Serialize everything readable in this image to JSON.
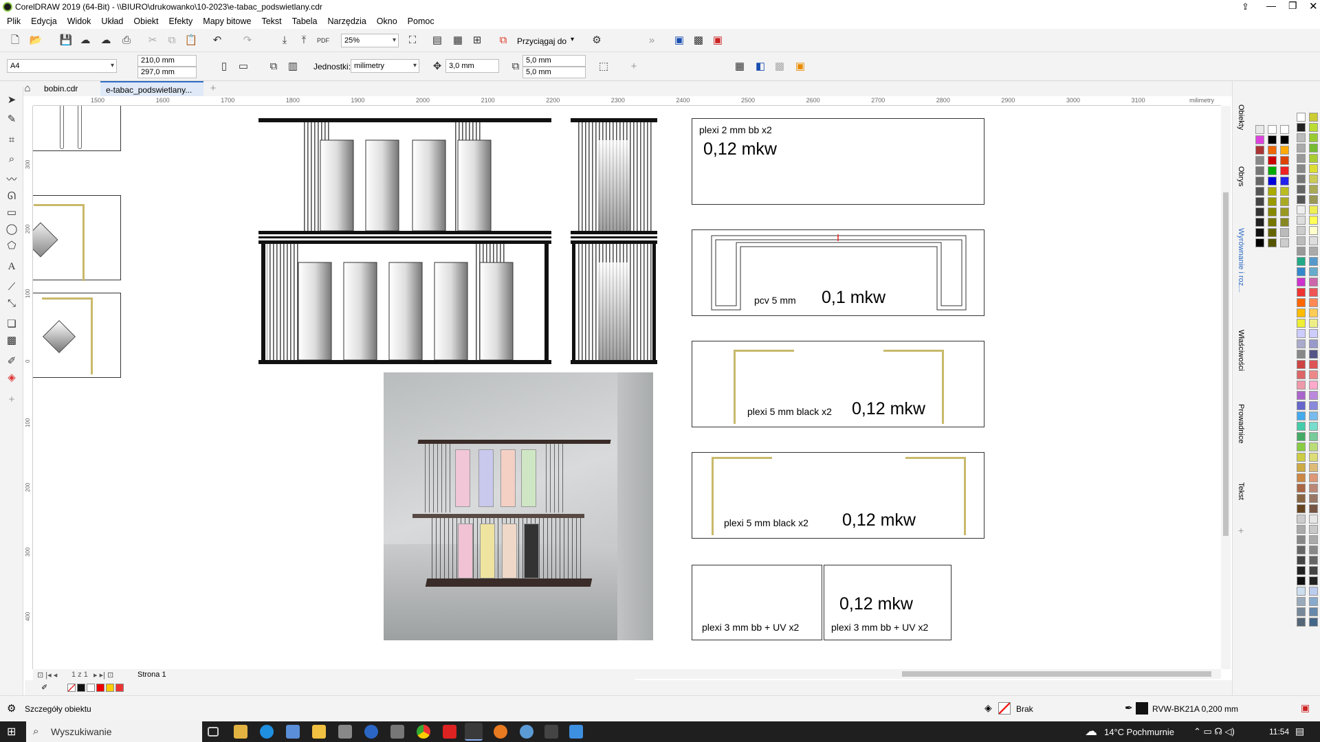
{
  "window": {
    "title": "CorelDRAW 2019 (64-Bit) - \\\\BIURO\\drukowanko\\10-2023\\e-tabac_podswietlany.cdr"
  },
  "menu": [
    "Plik",
    "Edycja",
    "Widok",
    "Układ",
    "Obiekt",
    "Efekty",
    "Mapy bitowe",
    "Tekst",
    "Tabela",
    "Narzędzia",
    "Okno",
    "Pomoc"
  ],
  "toolbar": {
    "zoom": "25%",
    "snap_label": "Przyciągaj do"
  },
  "propbar": {
    "page_size": "A4",
    "width": "210,0 mm",
    "height": "297,0 mm",
    "units_label": "Jednostki:",
    "units": "milimetry",
    "nudge": "3,0 mm",
    "dup_x": "5,0 mm",
    "dup_y": "5,0 mm"
  },
  "tabs": [
    "bobin.cdr",
    "e-tabac_podswietlany..."
  ],
  "ruler": {
    "unit": "milimetry",
    "ticks": [
      "1500",
      "1600",
      "1700",
      "1800",
      "1900",
      "2000",
      "2100",
      "2200",
      "2300",
      "2400",
      "2500",
      "2600",
      "2700",
      "2800",
      "2900",
      "3000",
      "3100"
    ],
    "vticks": [
      "300",
      "200",
      "100",
      "0",
      "100",
      "200",
      "300",
      "400"
    ]
  },
  "pages": {
    "nav": "1 z 1",
    "page": "Strona 1"
  },
  "docker_tabs": [
    "Obiekty",
    "Obrys",
    "Wyrównanie i roz...",
    "Właściwości",
    "Prowadnice",
    "Tekst"
  ],
  "panels": [
    {
      "small": "plexi 2 mm bb   x2",
      "big": "0,12 mkw"
    },
    {
      "small": "pcv 5 mm",
      "big": "0,1 mkw"
    },
    {
      "small": "plexi 5 mm black   x2",
      "big": "0,12 mkw"
    },
    {
      "small": "plexi 5 mm black   x2",
      "big": "0,12 mkw"
    },
    {
      "small": "plexi 3 mm bb + UV   x2",
      "big": ""
    },
    {
      "small": "plexi 3 mm bb + UV   x2",
      "big": "0,12 mkw"
    }
  ],
  "status": {
    "details": "Szczegóły obiektu",
    "fill": "Brak",
    "outline": "RVW-BK21A  0,200 mm"
  },
  "taskbar": {
    "search": "Wyszukiwanie",
    "weather": "14°C  Pochmurnie",
    "time": "11:54"
  },
  "colors": {
    "accent": "#c9b96a",
    "pcv_red": "#e22"
  }
}
